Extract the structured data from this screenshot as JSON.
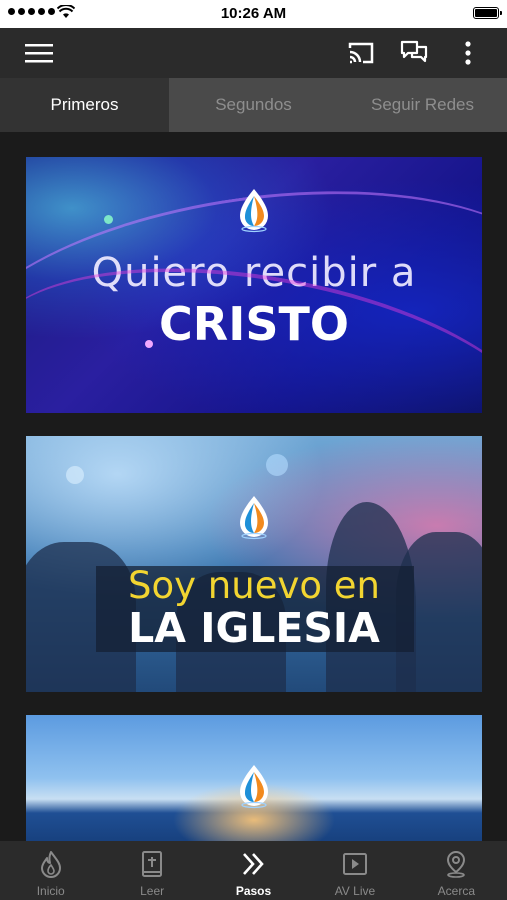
{
  "status_bar": {
    "time": "10:26 AM"
  },
  "toolbar": {
    "menu_icon": "hamburger-menu-icon",
    "cast_icon": "cast-icon",
    "chat_icon": "chat-icon",
    "more_icon": "more-vertical-icon"
  },
  "tabs": [
    {
      "label": "Primeros",
      "active": true
    },
    {
      "label": "Segundos",
      "active": false
    },
    {
      "label": "Seguir Redes",
      "active": false
    }
  ],
  "cards": [
    {
      "line1": "Quiero recibir a",
      "line2": "CRISTO"
    },
    {
      "line1": "Soy nuevo en",
      "line2": "LA IGLESIA"
    },
    {
      "line1": "",
      "line2": ""
    }
  ],
  "bottom_nav": [
    {
      "label": "Inicio",
      "icon": "flame-icon",
      "active": false
    },
    {
      "label": "Leer",
      "icon": "bible-icon",
      "active": false
    },
    {
      "label": "Pasos",
      "icon": "double-chevron-icon",
      "active": true
    },
    {
      "label": "AV Live",
      "icon": "play-icon",
      "active": false
    },
    {
      "label": "Acerca",
      "icon": "location-pin-icon",
      "active": false
    }
  ],
  "colors": {
    "toolbar_bg": "#2b2b2b",
    "tab_active_bg": "#333333",
    "tab_inactive_bg": "#4a4a4a",
    "accent_yellow": "#f2d531"
  }
}
